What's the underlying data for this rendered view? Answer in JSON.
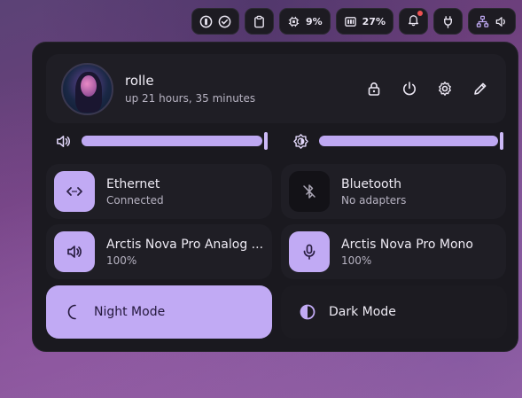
{
  "topbar": {
    "battery_percent": "9%",
    "memory_percent": "27%"
  },
  "user": {
    "name": "rolle",
    "uptime": "up 21 hours, 35 minutes"
  },
  "sliders": {
    "volume_level": 0.99,
    "brightness_level": 0.98
  },
  "tiles": [
    {
      "title": "Ethernet",
      "subtitle": "Connected",
      "icon": "ethernet-icon",
      "active": true
    },
    {
      "title": "Bluetooth",
      "subtitle": "No adapters",
      "icon": "bluetooth-off-icon",
      "active": false
    },
    {
      "title": "Arctis Nova Pro Analog ...",
      "subtitle": "100%",
      "icon": "speaker-icon",
      "active": true
    },
    {
      "title": "Arctis Nova Pro Mono",
      "subtitle": "100%",
      "icon": "microphone-icon",
      "active": true
    }
  ],
  "modes": {
    "night_label": "Night Mode",
    "dark_label": "Dark Mode"
  },
  "colors": {
    "accent": "#c1aaf4",
    "panel": "#1a191f",
    "notification_dot": "#ee5252"
  }
}
